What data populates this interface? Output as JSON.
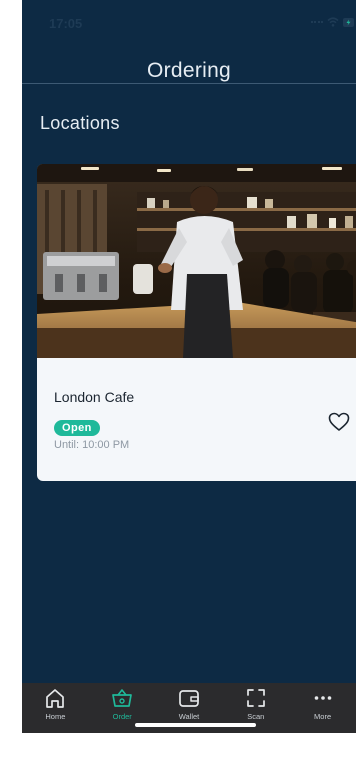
{
  "status_bar": {
    "time": "17:05"
  },
  "header": {
    "title": "Ordering"
  },
  "section": {
    "title": "Locations"
  },
  "locations": [
    {
      "name": "London Cafe",
      "status": "Open",
      "until": "Until: 10:00 PM"
    }
  ],
  "tab_bar": {
    "items": [
      {
        "label": "Home",
        "icon": "home-icon"
      },
      {
        "label": "Order",
        "icon": "basket-icon",
        "active": true
      },
      {
        "label": "Wallet",
        "icon": "wallet-icon"
      },
      {
        "label": "Scan",
        "icon": "scan-icon"
      },
      {
        "label": "More",
        "icon": "more-icon"
      }
    ]
  },
  "colors": {
    "background": "#0d2a44",
    "accent": "#1fb99a",
    "card": "#f4f7fa",
    "tab_bar": "#2b2b2d"
  }
}
